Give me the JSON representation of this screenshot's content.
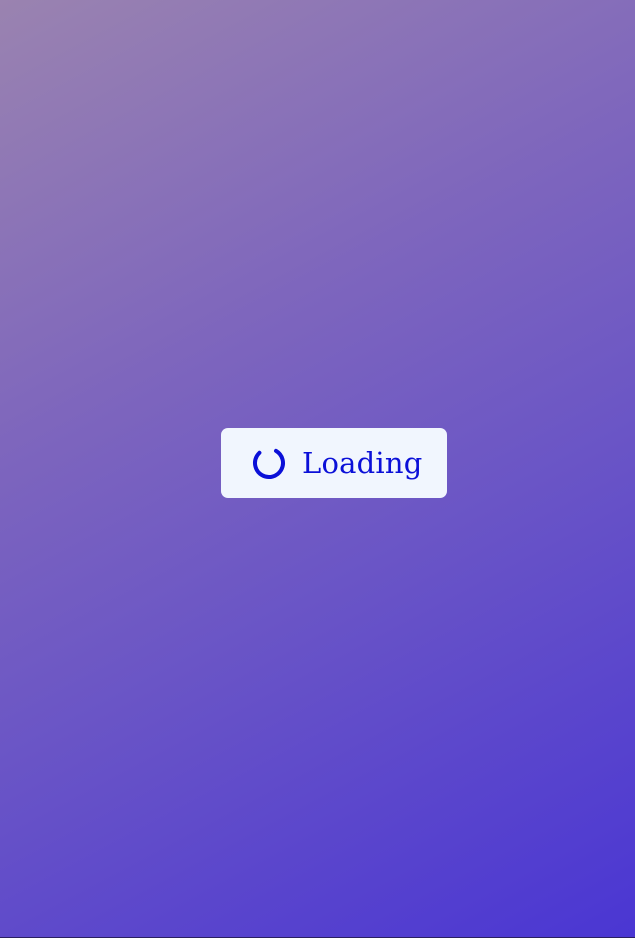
{
  "status": {
    "label": "Loading",
    "icon": "spinner-icon",
    "accent_color": "#0b10d8"
  },
  "colors": {
    "pill_background": "#f1f6fe",
    "gradient_start": "#9a83b0",
    "gradient_end": "#4a36d3"
  }
}
